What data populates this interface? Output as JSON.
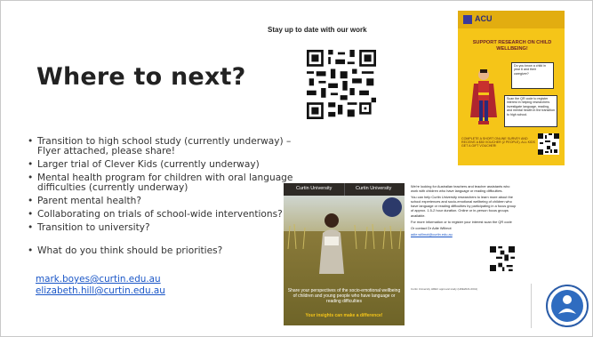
{
  "slide": {
    "title": "Where to next?",
    "bullets": [
      "Transition to high school study (currently underway) – Flyer attached, please share!",
      "Larger trial of Clever Kids (currently underway)",
      "Mental health program for children with oral language difficulties (currently underway)",
      "Parent mental health?",
      "Collaborating on trials of school-wide interventions?",
      "Transition to university?"
    ],
    "question": "What do you think should be priorities?",
    "emails": [
      "mark.boyes@curtin.edu.au",
      "elizabeth.hill@curtin.edu.au"
    ],
    "stay_label": "Stay up to date with our work"
  },
  "flyer1": {
    "logo_text": "ACU",
    "title": "SUPPORT RESEARCH ON CHILD WELLBEING!",
    "box1": "Do you know a child in year 6 and their caregiver?",
    "box2": "Scan the QR code to register interest in helping researchers investigate language, reading, and mental health in the transition to high school.",
    "footer": "COMPLETE A SHORT ONLINE SURVEY AND RECEIVE A $50 VOUCHER (2 PEOPLE). ALL KIDS GET A GIFT VOUCHER!"
  },
  "flyer2": {
    "header_left": "Curtin University",
    "header_right": "Curtin University",
    "text": "Share your perspectives of the socio-emotional wellbeing of children and young people who have language or reading difficulties",
    "tagline": "Your insights can make a difference!"
  },
  "desc": {
    "p1": "We're looking for Australian teachers and teacher assistants who work with children who have language or reading difficulties.",
    "p2": "You can help Curtin University researchers to learn more about the school experiences and socio-emotional wellbeing of children who have language or reading difficulties by participating in a focus group of approx. 1.5-2 hour duration. Online or in-person focus groups available.",
    "p3": "For more information or to register your interest scan the QR code",
    "contact": "Or contact Dr Adie Willmot",
    "contact_email": "adie.willmot@curtin.edu.au",
    "footer": "Curtin University HREC approval study (HRE2021-0041)"
  }
}
